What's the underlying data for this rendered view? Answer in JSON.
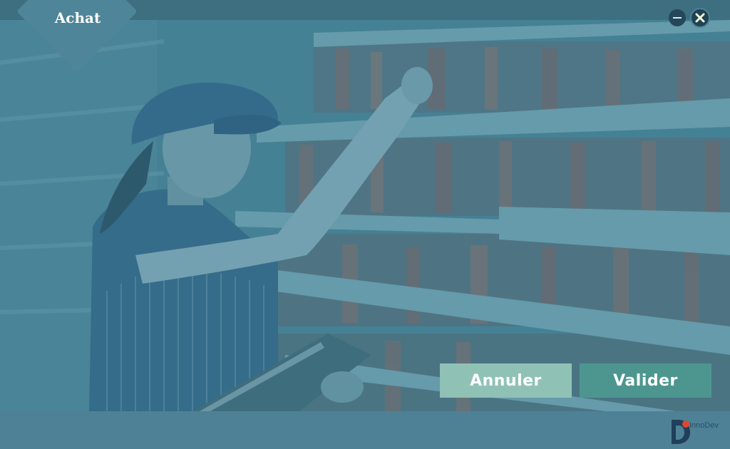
{
  "window": {
    "title": "Achat",
    "minimize_icon": "minus-icon",
    "close_icon": "close-icon"
  },
  "actions": {
    "cancel_label": "Annuler",
    "validate_label": "Valider"
  },
  "branding": {
    "logo_text": "InnoDev",
    "logo_subtext": ""
  },
  "colors": {
    "title_bar": "#3d6f80",
    "overlay": "#4e8196",
    "cancel_button": "#8fc2b5",
    "validate_button": "#4d9690",
    "window_control": "#24485a"
  }
}
